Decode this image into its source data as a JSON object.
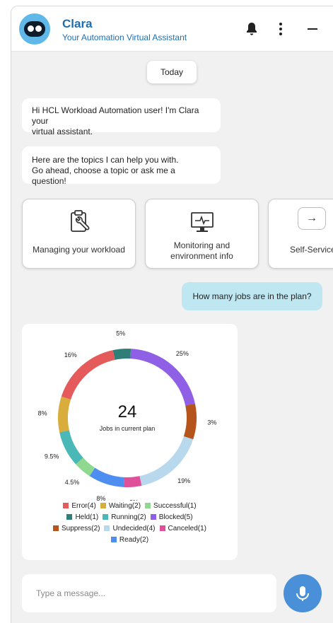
{
  "header": {
    "title": "Clara",
    "subtitle": "Your Automation Virtual Assistant",
    "icons": [
      "bell-icon",
      "more-vertical-icon",
      "minimize-icon"
    ]
  },
  "chat": {
    "date_chip": "Today",
    "greeting": [
      "Hi HCL Workload Automation user! I'm Clara your",
      "virtual assistant."
    ],
    "topics_intro": [
      "Here are the topics I can help you with.",
      "Go ahead, choose a topic or ask me a question!"
    ],
    "topics": [
      {
        "lines": [
          "Managing your workload"
        ],
        "icon": "clipboard-wrench-icon"
      },
      {
        "lines": [
          "Monitoring and",
          "environment info"
        ],
        "icon": "monitor-pulse-icon"
      },
      {
        "lines": [
          "Self-Service"
        ],
        "icon": "self-service-icon"
      }
    ],
    "scroll_next": "→",
    "user_message": "How many jobs are in the plan?"
  },
  "chart_data": {
    "type": "donut",
    "center_value": "24",
    "center_label": "Jobs in current plan",
    "slices": [
      {
        "name": "Held",
        "count": 1,
        "label": "5%",
        "color": "#2f7f78"
      },
      {
        "name": "Blocked",
        "count": 5,
        "label": "25%",
        "color": "#8f60e6"
      },
      {
        "name": "Suppress",
        "count": 2,
        "label": "3%",
        "color": "#b5541c"
      },
      {
        "name": "Undecided",
        "count": 4,
        "label": "19%",
        "color": "#b8d8ee"
      },
      {
        "name": "Canceled",
        "count": 1,
        "label": "2%",
        "color": "#e0509a"
      },
      {
        "name": "Ready",
        "count": 2,
        "label": "8%",
        "color": "#4e8ef0"
      },
      {
        "name": "Successful",
        "count": 1,
        "label": "4.5%",
        "color": "#8fd88f"
      },
      {
        "name": "Running",
        "count": 2,
        "label": "9.5%",
        "color": "#4bb8b8"
      },
      {
        "name": "Waiting",
        "count": 2,
        "label": "8%",
        "color": "#d9ad3c"
      },
      {
        "name": "Error",
        "count": 4,
        "label": "16%",
        "color": "#e55a5a"
      }
    ],
    "legend_rows": [
      [
        {
          "text": "Error(4)",
          "color": "#e55a5a"
        },
        {
          "text": "Waiting(2)",
          "color": "#d9ad3c"
        },
        {
          "text": "Successful(1)",
          "color": "#8fd88f"
        }
      ],
      [
        {
          "text": "Held(1)",
          "color": "#2f7f78"
        },
        {
          "text": "Running(2)",
          "color": "#4bb8b8"
        },
        {
          "text": "Blocked(5)",
          "color": "#8f60e6"
        }
      ],
      [
        {
          "text": "Suppress(2)",
          "color": "#b5541c"
        },
        {
          "text": "Undecided(4)",
          "color": "#b8d8ee"
        },
        {
          "text": "Canceled(1)",
          "color": "#e0509a"
        }
      ],
      [
        {
          "text": "Ready(2)",
          "color": "#4e8ef0"
        }
      ]
    ]
  },
  "composer": {
    "placeholder": "Type a message...",
    "mic_icon": "microphone-icon"
  },
  "colors": {
    "brand": "#1e6fb0",
    "user_bubble": "#bfe7f2",
    "mic_button": "#4a90d9"
  }
}
